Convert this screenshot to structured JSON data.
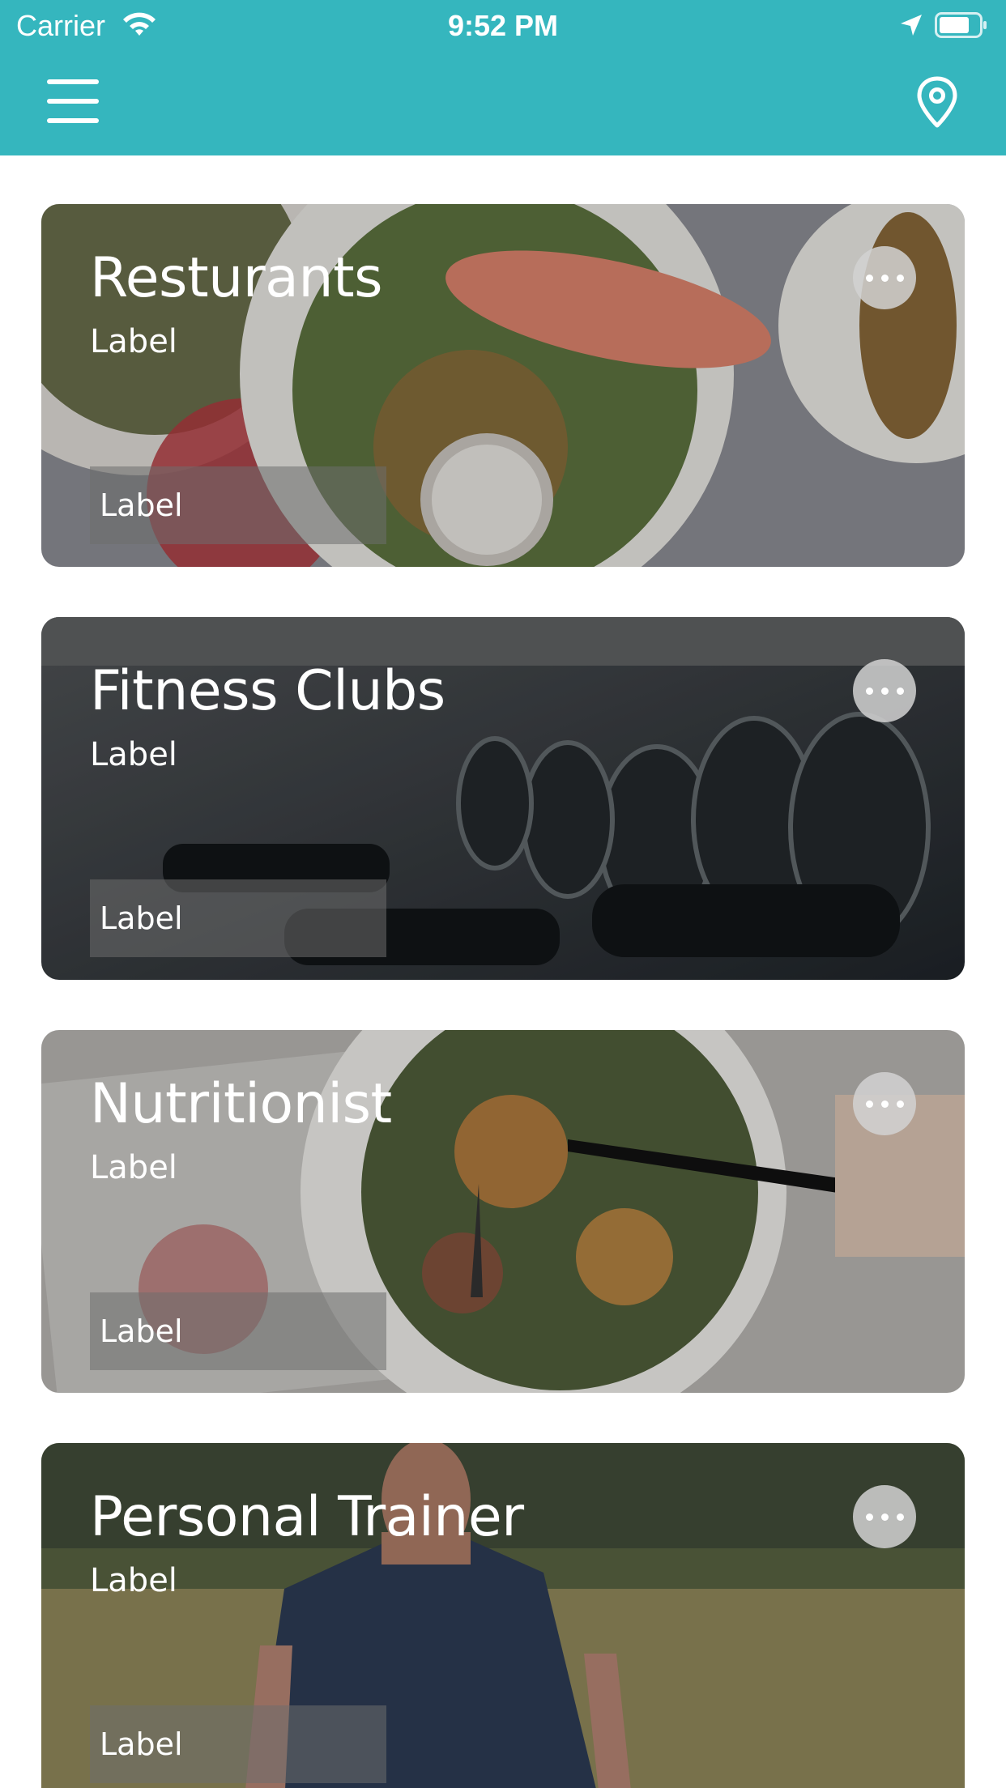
{
  "status_bar": {
    "carrier": "Carrier",
    "time": "9:52 PM",
    "icons": [
      "wifi-icon",
      "location-arrow-icon",
      "battery-icon"
    ]
  },
  "nav_bar": {
    "left_icon": "hamburger-menu-icon",
    "right_icon": "map-pin-icon",
    "background_color": "#35b6be"
  },
  "categories": [
    {
      "title": "Resturants",
      "subtitle": "Label",
      "tag": "Label",
      "more_icon": "ellipsis-icon"
    },
    {
      "title": "Fitness Clubs",
      "subtitle": "Label",
      "tag": "Label",
      "more_icon": "ellipsis-icon"
    },
    {
      "title": "Nutritionist",
      "subtitle": "Label",
      "tag": "Label",
      "more_icon": "ellipsis-icon"
    },
    {
      "title": "Personal Trainer",
      "subtitle": "Label",
      "tag": "Label",
      "more_icon": "ellipsis-icon"
    }
  ]
}
